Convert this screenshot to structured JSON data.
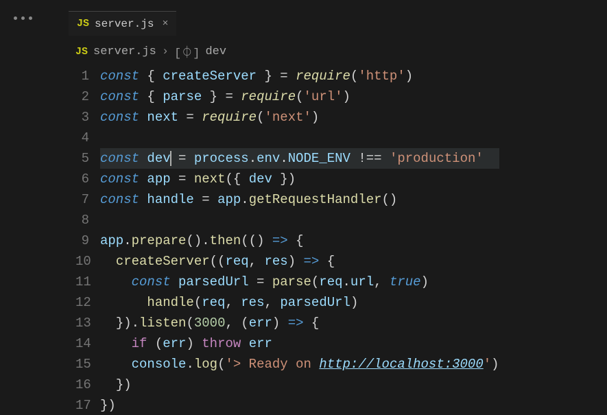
{
  "tab": {
    "icon": "JS",
    "filename": "server.js",
    "close": "×"
  },
  "breadcrumb": {
    "icon": "JS",
    "file": "server.js",
    "chevron": "›",
    "symbolIcon": "[⏀]",
    "symbol": "dev"
  },
  "lineCount": 17,
  "code": {
    "l1": {
      "kw": "const",
      "brace1": " { ",
      "var": "createServer",
      "brace2": " } ",
      "eq": "= ",
      "fn": "require",
      "p1": "(",
      "str": "'http'",
      "p2": ")"
    },
    "l2": {
      "kw": "const",
      "brace1": " { ",
      "var": "parse",
      "brace2": " } ",
      "eq": "= ",
      "fn": "require",
      "p1": "(",
      "str": "'url'",
      "p2": ")"
    },
    "l3": {
      "kw": "const",
      "sp": " ",
      "var": "next",
      "eq": " = ",
      "fn": "require",
      "p1": "(",
      "str": "'next'",
      "p2": ")"
    },
    "l4": "",
    "l5": {
      "kw": "const",
      "sp": " ",
      "var": "dev",
      "eq": " = ",
      "prop1": "process",
      "dot1": ".",
      "prop2": "env",
      "dot2": ".",
      "prop3": "NODE_ENV",
      "op": " !== ",
      "str": "'production'"
    },
    "l6": {
      "kw": "const",
      "sp": " ",
      "var": "app",
      "eq": " = ",
      "fn": "next",
      "p1": "({ ",
      "prop": "dev",
      "p2": " })"
    },
    "l7": {
      "kw": "const",
      "sp": " ",
      "var": "handle",
      "eq": " = ",
      "obj": "app",
      "dot": ".",
      "fn": "getRequestHandler",
      "p": "()"
    },
    "l8": "",
    "l9": {
      "obj": "app",
      "dot1": ".",
      "fn1": "prepare",
      "p1": "()",
      "dot2": ".",
      "fn2": "then",
      "p2": "(()",
      "arrow": " => ",
      "brace": "{"
    },
    "l10": {
      "indent": "  ",
      "fn": "createServer",
      "p1": "((",
      "arg1": "req",
      "c": ", ",
      "arg2": "res",
      "p2": ")",
      "arrow": " => ",
      "brace": "{"
    },
    "l11": {
      "indent": "    ",
      "kw": "const",
      "sp": " ",
      "var": "parsedUrl",
      "eq": " = ",
      "fn": "parse",
      "p1": "(",
      "arg1": "req",
      "dot": ".",
      "prop": "url",
      "c": ", ",
      "bool": "true",
      "p2": ")"
    },
    "l12": {
      "indent": "      ",
      "fn": "handle",
      "p1": "(",
      "arg1": "req",
      "c1": ", ",
      "arg2": "res",
      "c2": ", ",
      "arg3": "parsedUrl",
      "p2": ")"
    },
    "l13": {
      "indent": "  ",
      "p1": "}).",
      "fn": "listen",
      "p2": "(",
      "num": "3000",
      "c": ", ",
      "p3": "(",
      "arg": "err",
      "p4": ")",
      "arrow": " => ",
      "brace": "{"
    },
    "l14": {
      "indent": "    ",
      "kw1": "if",
      "p1": " (",
      "arg": "err",
      "p2": ") ",
      "kw2": "throw",
      "sp": " ",
      "var": "err"
    },
    "l15": {
      "indent": "    ",
      "obj": "console",
      "dot": ".",
      "fn": "log",
      "p1": "(",
      "str1": "'> Ready on ",
      "url": "http://localhost:3000",
      "str2": "'",
      "p2": ")"
    },
    "l16": {
      "indent": "  ",
      "brace": "})"
    },
    "l17": {
      "brace": "})"
    }
  }
}
